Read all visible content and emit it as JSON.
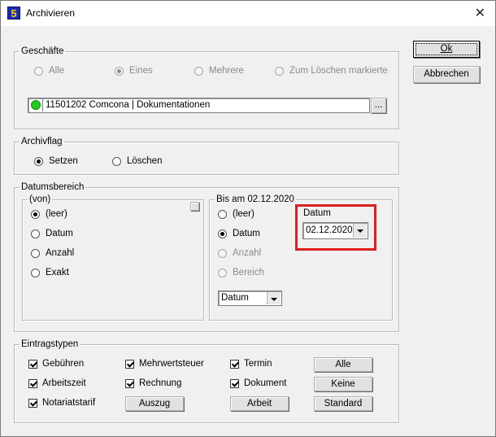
{
  "window": {
    "title": "Archivieren",
    "icon_text": "5",
    "close_glyph": "✕"
  },
  "buttons": {
    "ok": "Ok",
    "cancel": "Abbrechen"
  },
  "geschaefte": {
    "legend": "Geschäfte",
    "options": [
      "Alle",
      "Eines",
      "Mehrere",
      "Zum Löschen markierte"
    ],
    "selected": "Eines",
    "entry": "11501202 Comcona | Dokumentationen",
    "browse_label": "...",
    "status_color": "#22cc22"
  },
  "archivflag": {
    "legend": "Archivflag",
    "options": [
      "Setzen",
      "Löschen"
    ],
    "selected": "Setzen"
  },
  "datumsbereich": {
    "legend": "Datumsbereich",
    "von": {
      "legend": "(von)",
      "options": [
        "(leer)",
        "Datum",
        "Anzahl",
        "Exakt"
      ],
      "selected": "(leer)"
    },
    "bis": {
      "legend": "Bis am 02.12.2020",
      "options": [
        "(leer)",
        "Datum",
        "Anzahl",
        "Bereich"
      ],
      "selected": "Datum",
      "datum_label": "Datum",
      "datum_value": "02.12.2020",
      "type_value": "Datum"
    }
  },
  "eintragstypen": {
    "legend": "Eintragstypen",
    "checks": [
      "Gebühren",
      "Mehrwertsteuer",
      "Termin",
      "Arbeitszeit",
      "Rechnung",
      "Dokument",
      "Notariatstarif"
    ],
    "buttons": {
      "alle": "Alle",
      "keine": "Keine",
      "standard": "Standard",
      "auszug": "Auszug",
      "arbeit": "Arbeit"
    }
  },
  "colors": {
    "highlight": "#e01e1e",
    "titlebar": "#ffffff",
    "background": "#f0f0f0"
  }
}
